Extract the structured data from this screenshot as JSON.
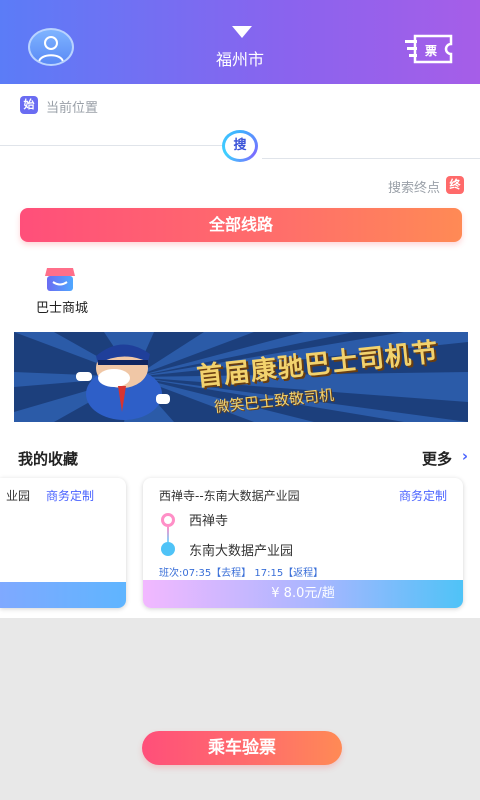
{
  "header": {
    "city": "福州市",
    "ticket_label": "票"
  },
  "search": {
    "start_badge": "始",
    "start_placeholder": "当前位置",
    "search_button": "搜",
    "end_placeholder": "搜索终点",
    "end_badge": "终"
  },
  "all_routes_button": "全部线路",
  "shortcuts": [
    {
      "label": "巴士商城",
      "icon": "shop-icon"
    }
  ],
  "banner": {
    "title": "首届康驰巴士司机节",
    "subtitle": "微笑巴士致敬司机"
  },
  "favorites": {
    "title": "我的收藏",
    "more": "更多",
    "more_arrow": "›",
    "cards": [
      {
        "route": "业园",
        "tag": "商务定制"
      },
      {
        "route": "西禅寺--东南大数据产业园",
        "tag": "商务定制",
        "start_stop": "西禅寺",
        "end_stop": "东南大数据产业园",
        "schedule": "班次:07:35【去程】 17:15【返程】",
        "price": "¥ 8.0元/趟"
      }
    ]
  },
  "verify_button": "乘车验票",
  "colors": {
    "header_gradient_start": "#5b7cf7",
    "header_gradient_end": "#a65ee8",
    "accent_red": "#ff4f7a",
    "accent_blue": "#4a63ff"
  }
}
